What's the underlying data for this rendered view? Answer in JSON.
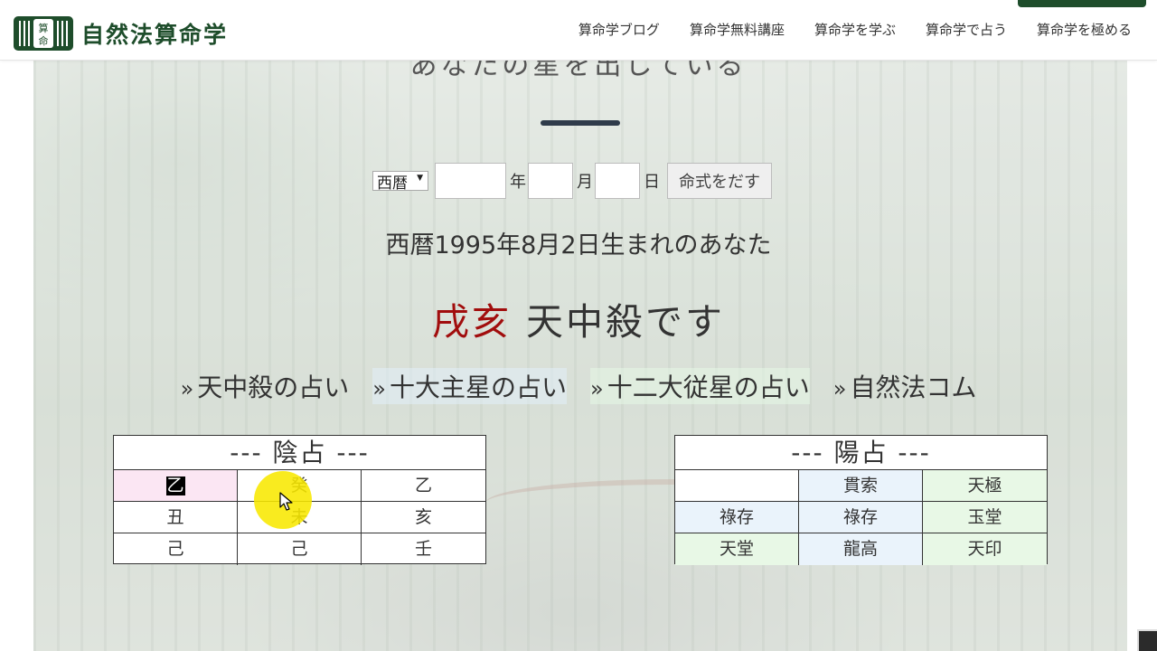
{
  "site": {
    "logo_text": "自然法算命学",
    "logo_mark_chars": [
      "算",
      "命"
    ]
  },
  "nav": {
    "items": [
      "算命学ブログ",
      "算命学無料講座",
      "算命学を学ぶ",
      "算命学で占う",
      "算命学を極める"
    ]
  },
  "hero": {
    "heading_partial": "あなたの星を出している"
  },
  "form": {
    "era_selected": "西暦",
    "year_unit": "年",
    "month_unit": "月",
    "day_unit": "日",
    "year_value": "",
    "month_value": "",
    "day_value": "",
    "submit_label": "命式をだす"
  },
  "result": {
    "birth_line": "西暦1995年8月2日生まれのあなた",
    "tenchusatsu": "戌亥",
    "suffix": "天中殺です"
  },
  "links": [
    {
      "label": "天中殺の占い"
    },
    {
      "label": "十大主星の占い"
    },
    {
      "label": "十二大従星の占い"
    },
    {
      "label": "自然法コム"
    }
  ],
  "link_prefix": "»",
  "yin_table": {
    "title": "--- 陰占 ---",
    "rows": [
      [
        "乙",
        "癸",
        "乙"
      ],
      [
        "丑",
        "未",
        "亥"
      ],
      [
        "己",
        "己",
        "壬"
      ]
    ]
  },
  "yang_table": {
    "title": "--- 陽占 ---",
    "rows": [
      [
        "",
        "貫索",
        "天極"
      ],
      [
        "祿存",
        "祿存",
        "玉堂"
      ],
      [
        "天堂",
        "龍高",
        "天印"
      ]
    ]
  },
  "colors": {
    "brand_green": "#1e4d2b",
    "tenchusatsu_red": "#a10d0d",
    "cursor_highlight": "#f8e800"
  }
}
